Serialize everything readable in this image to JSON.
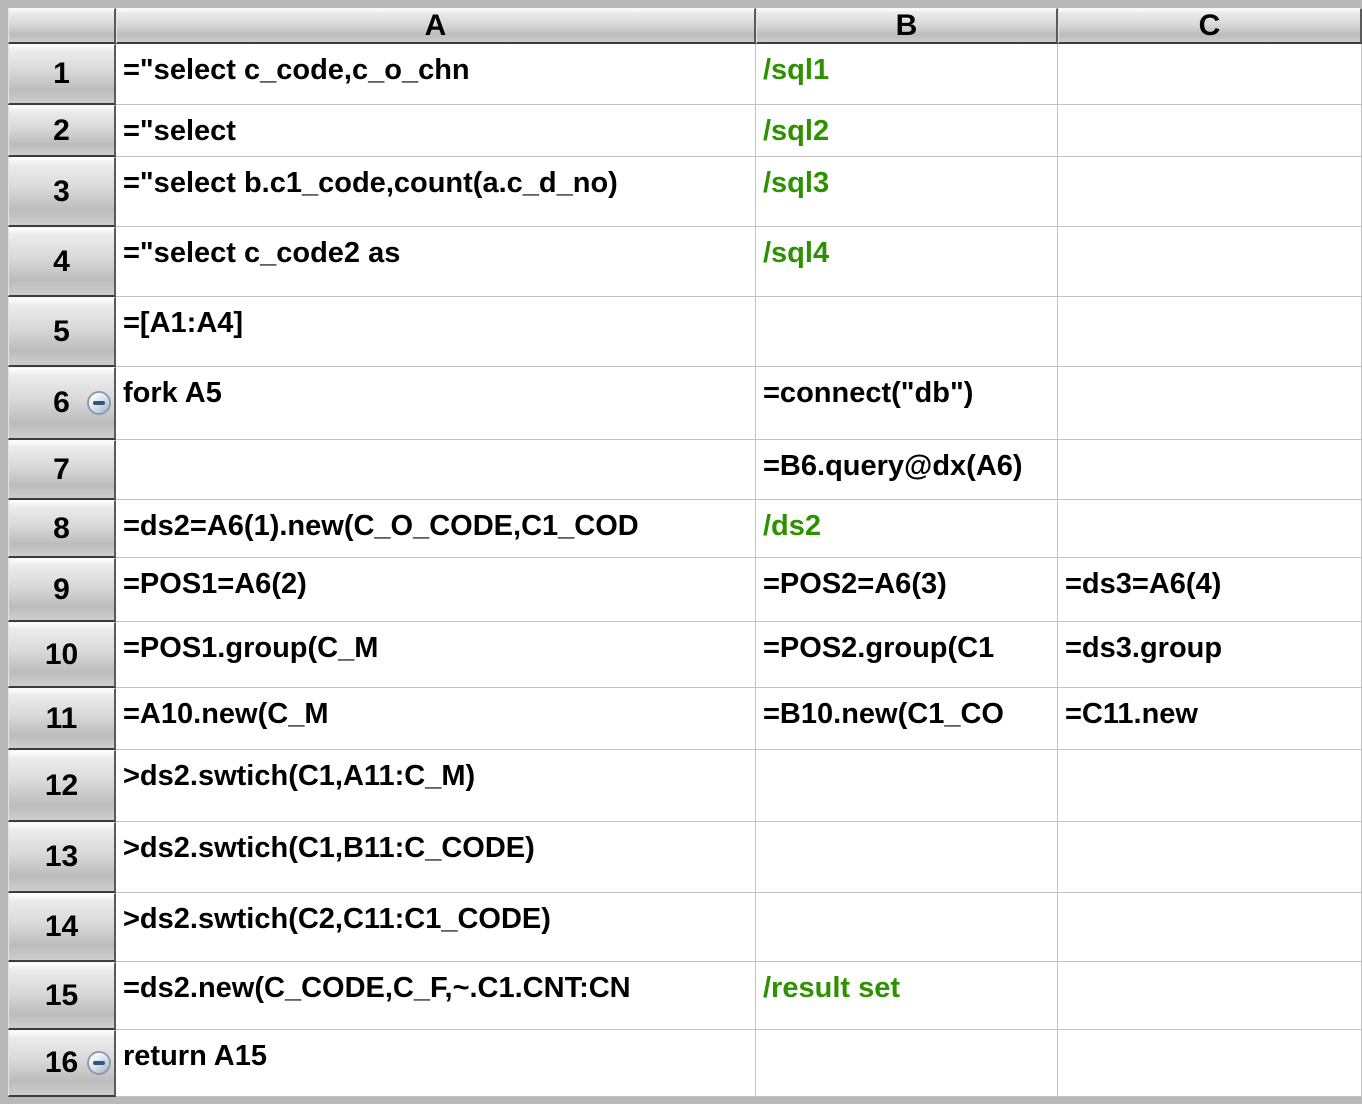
{
  "colors": {
    "comment_green": "#2e9100",
    "code_text": "#000000",
    "grid_line": "#c3c3c3"
  },
  "grid": {
    "column_headers": [
      "A",
      "B",
      "C"
    ],
    "rows": [
      {
        "num": "1",
        "collapse": false,
        "cells": {
          "A": {
            "text": "=\"select c_code,c_o_chn",
            "type": "code"
          },
          "B": {
            "text": "/sql1",
            "type": "comment"
          },
          "C": {
            "text": "",
            "type": "code"
          }
        }
      },
      {
        "num": "2",
        "collapse": false,
        "cells": {
          "A": {
            "text": "=\"select",
            "type": "code"
          },
          "B": {
            "text": "/sql2",
            "type": "comment"
          },
          "C": {
            "text": "",
            "type": "code"
          }
        }
      },
      {
        "num": "3",
        "collapse": false,
        "cells": {
          "A": {
            "text": "=\"select b.c1_code,count(a.c_d_no)",
            "type": "code"
          },
          "B": {
            "text": "/sql3",
            "type": "comment"
          },
          "C": {
            "text": "",
            "type": "code"
          }
        }
      },
      {
        "num": "4",
        "collapse": false,
        "cells": {
          "A": {
            "text": "=\"select c_code2 as",
            "type": "code"
          },
          "B": {
            "text": "/sql4",
            "type": "comment"
          },
          "C": {
            "text": "",
            "type": "code"
          }
        }
      },
      {
        "num": "5",
        "collapse": false,
        "cells": {
          "A": {
            "text": "=[A1:A4]",
            "type": "code"
          },
          "B": {
            "text": "",
            "type": "code"
          },
          "C": {
            "text": "",
            "type": "code"
          }
        }
      },
      {
        "num": "6",
        "collapse": true,
        "cells": {
          "A": {
            "text": "fork A5",
            "type": "code"
          },
          "B": {
            "text": "=connect(\"db\")",
            "type": "code"
          },
          "C": {
            "text": "",
            "type": "code"
          }
        }
      },
      {
        "num": "7",
        "collapse": false,
        "cells": {
          "A": {
            "text": "",
            "type": "code"
          },
          "B": {
            "text": "=B6.query@dx(A6)",
            "type": "code"
          },
          "C": {
            "text": "",
            "type": "code"
          }
        }
      },
      {
        "num": "8",
        "collapse": false,
        "cells": {
          "A": {
            "text": "=ds2=A6(1).new(C_O_CODE,C1_COD",
            "type": "code"
          },
          "B": {
            "text": "/ds2",
            "type": "comment"
          },
          "C": {
            "text": "",
            "type": "code"
          }
        }
      },
      {
        "num": "9",
        "collapse": false,
        "cells": {
          "A": {
            "text": "=POS1=A6(2)",
            "type": "code"
          },
          "B": {
            "text": "=POS2=A6(3)",
            "type": "code"
          },
          "C": {
            "text": "=ds3=A6(4)",
            "type": "code"
          }
        }
      },
      {
        "num": "10",
        "collapse": false,
        "cells": {
          "A": {
            "text": "=POS1.group(C_M",
            "type": "code"
          },
          "B": {
            "text": "=POS2.group(C1",
            "type": "code"
          },
          "C": {
            "text": "=ds3.group",
            "type": "code"
          }
        }
      },
      {
        "num": "11",
        "collapse": false,
        "cells": {
          "A": {
            "text": "=A10.new(C_M",
            "type": "code"
          },
          "B": {
            "text": "=B10.new(C1_CO",
            "type": "code"
          },
          "C": {
            "text": "=C11.new",
            "type": "code"
          }
        }
      },
      {
        "num": "12",
        "collapse": false,
        "cells": {
          "A": {
            "text": ">ds2.swtich(C1,A11:C_M)",
            "type": "code"
          },
          "B": {
            "text": "",
            "type": "code"
          },
          "C": {
            "text": "",
            "type": "code"
          }
        }
      },
      {
        "num": "13",
        "collapse": false,
        "cells": {
          "A": {
            "text": ">ds2.swtich(C1,B11:C_CODE)",
            "type": "code"
          },
          "B": {
            "text": "",
            "type": "code"
          },
          "C": {
            "text": "",
            "type": "code"
          }
        }
      },
      {
        "num": "14",
        "collapse": false,
        "cells": {
          "A": {
            "text": ">ds2.swtich(C2,C11:C1_CODE)",
            "type": "code"
          },
          "B": {
            "text": "",
            "type": "code"
          },
          "C": {
            "text": "",
            "type": "code"
          }
        }
      },
      {
        "num": "15",
        "collapse": false,
        "cells": {
          "A": {
            "text": "=ds2.new(C_CODE,C_F,~.C1.CNT:CN",
            "type": "code"
          },
          "B": {
            "text": "/result set",
            "type": "comment"
          },
          "C": {
            "text": "",
            "type": "code"
          }
        }
      },
      {
        "num": "16",
        "collapse": true,
        "cells": {
          "A": {
            "text": "return A15",
            "type": "code"
          },
          "B": {
            "text": "",
            "type": "code"
          },
          "C": {
            "text": "",
            "type": "code"
          }
        }
      }
    ]
  }
}
